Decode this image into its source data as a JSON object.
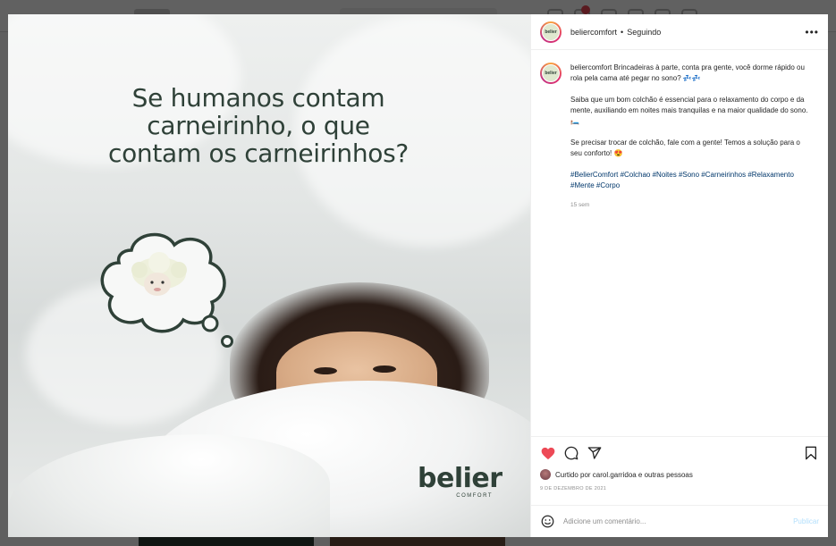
{
  "post": {
    "username": "beliercomfort",
    "separator": "•",
    "follow_status": "Seguindo",
    "more_label": "•••",
    "avatar_text": "belier"
  },
  "media": {
    "headline": "Se humanos contam carneirinho, o que contam os carneirinhos?",
    "brand_name": "belier",
    "brand_sub": "COMFORT"
  },
  "caption": {
    "username": "beliercomfort",
    "text1": "Brincadeiras à parte, conta pra gente, você dorme rápido ou rola pela cama até pegar no sono? 💤💤",
    "text2": "Saiba que um bom colchão é essencial para o relaxamento do corpo e da mente, auxiliando em noites mais tranquilas e na maior qualidade do sono. 🛏️",
    "text3": "Se precisar trocar de colchão, fale com a gente! Temos a solução para o seu conforto! 😍",
    "hashtags": "#BelierComfort #Colchao #Noites #Sono #Carneirinhos #Relaxamento #Mente #Corpo",
    "time": "15 sem"
  },
  "engagement": {
    "likes_text": "Curtido por carol.garridoa e outras pessoas",
    "date": "9 DE DEZEMBRO DE 2021"
  },
  "comment": {
    "placeholder": "Adicione um comentário...",
    "publish_label": "Publicar"
  },
  "icons": {
    "like": "heart-icon",
    "comment": "comment-icon",
    "share": "share-icon",
    "save": "bookmark-icon",
    "emoji": "emoji-icon"
  },
  "colors": {
    "like_active": "#ed4956",
    "hashtag": "#00376b",
    "brand": "#2f4138",
    "publish_disabled": "#b2dffc"
  }
}
